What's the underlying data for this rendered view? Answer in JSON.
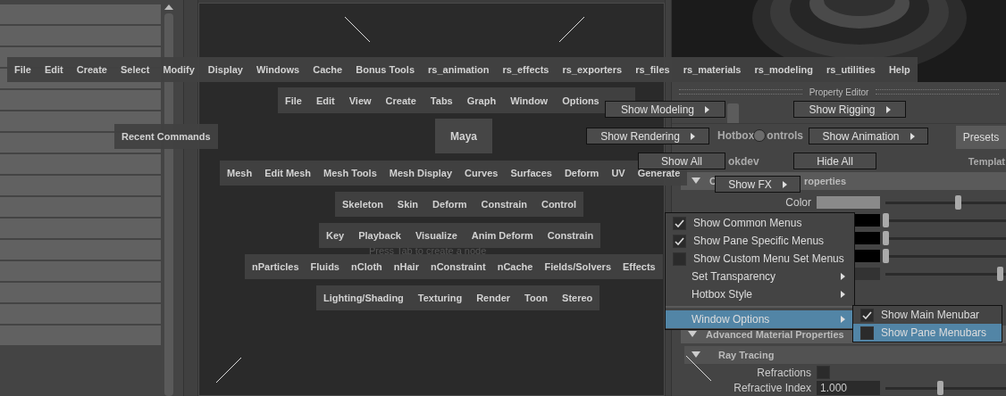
{
  "node_editor": {
    "hint": "Press Tab to create a node"
  },
  "property_editor": {
    "title": "Property Editor",
    "presets_button": "Presets",
    "lookdev_fragment": "okdev",
    "template_fragment": "Templat",
    "section": {
      "label_start": "C",
      "label_end": "roperties",
      "expanded": true
    },
    "attribute_rows": [
      {
        "kind": "color",
        "label": "Color",
        "level": 0.6
      },
      {
        "kind": "color",
        "level": 0
      },
      {
        "kind": "color",
        "level": 0
      },
      {
        "kind": "color",
        "level": 0
      },
      {
        "kind": "value",
        "level": 0.95
      }
    ],
    "advanced_section": {
      "label": "Advanced Material Properties",
      "expanded": true
    },
    "subsection": {
      "label": "Ray Tracing",
      "expanded": true
    },
    "refractions": {
      "label": "Refractions",
      "checked": false
    },
    "refractive_index": {
      "label": "Refractive Index",
      "value": "1.000",
      "level": 0.45
    }
  },
  "hotbox": {
    "main_menubar": [
      "File",
      "Edit",
      "Create",
      "Select",
      "Modify",
      "Display",
      "Windows",
      "Cache",
      "Bonus Tools",
      "rs_animation",
      "rs_effects",
      "rs_exporters",
      "rs_files",
      "rs_materials",
      "rs_modeling",
      "rs_utilities",
      "Help"
    ],
    "pane_menubar": [
      "File",
      "Edit",
      "View",
      "Create",
      "Tabs",
      "Graph",
      "Window",
      "Options"
    ],
    "recent_commands": "Recent Commands",
    "center": "Maya",
    "menu_sets": [
      [
        "Mesh",
        "Edit Mesh",
        "Mesh Tools",
        "Mesh Display",
        "Curves",
        "Surfaces",
        "Deform",
        "UV",
        "Generate"
      ],
      [
        "Skeleton",
        "Skin",
        "Deform",
        "Constrain",
        "Control"
      ],
      [
        "Key",
        "Playback",
        "Visualize",
        "Anim Deform",
        "Constrain"
      ],
      [
        "nParticles",
        "Fluids",
        "nCloth",
        "nHair",
        "nConstraint",
        "nCache",
        "Fields/Solvers",
        "Effects"
      ],
      [
        "Lighting/Shading",
        "Texturing",
        "Render",
        "Toon",
        "Stereo"
      ]
    ],
    "controls_label": [
      "Hotbox",
      "ontrols"
    ],
    "marking_menu": [
      {
        "label": "Show Modeling",
        "submenu": true
      },
      {
        "label": "Show Rigging",
        "submenu": true
      },
      {
        "label": "Show Rendering",
        "submenu": true
      },
      {
        "label": "Show Animation",
        "submenu": true
      },
      {
        "label": "Show All",
        "submenu": false
      },
      {
        "label": "Hide All",
        "submenu": false
      },
      {
        "label": "Show FX",
        "submenu": true
      }
    ],
    "context_menu": [
      {
        "kind": "check",
        "label": "Show Common Menus",
        "checked": true
      },
      {
        "kind": "check",
        "label": "Show Pane Specific Menus",
        "checked": true
      },
      {
        "kind": "check",
        "label": "Show Custom Menu Set Menus",
        "checked": false
      },
      {
        "kind": "submenu",
        "label": "Set Transparency",
        "selected": false
      },
      {
        "kind": "submenu",
        "label": "Hotbox Style",
        "selected": false
      },
      {
        "kind": "divider"
      },
      {
        "kind": "submenu",
        "label": "Window Options",
        "selected": true
      }
    ],
    "submenu": [
      {
        "label": "Show Main Menubar",
        "checked": true,
        "selected": false
      },
      {
        "label": "Show Pane Menubars",
        "checked": false,
        "selected": true
      }
    ]
  }
}
